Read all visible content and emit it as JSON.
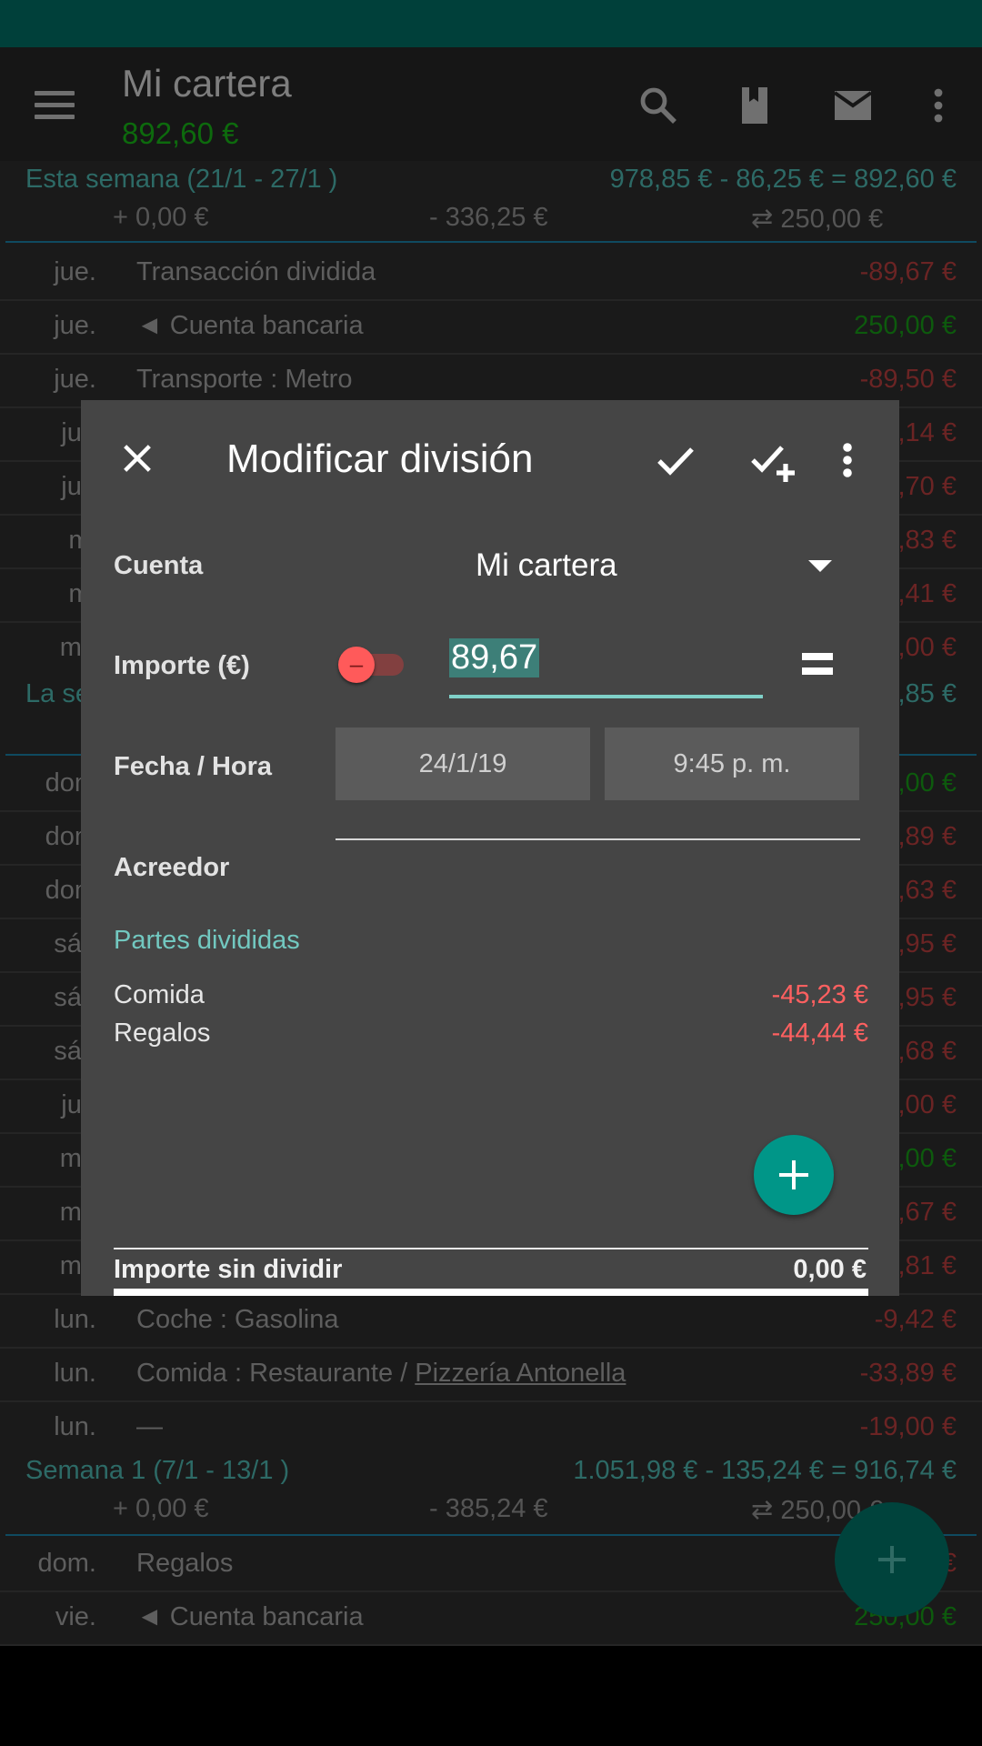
{
  "app": {
    "title": "Mi cartera",
    "balance": "892,60 €",
    "colors": {
      "accent": "#009688",
      "negative": "#ff6060",
      "positive": "#1a9a1a",
      "header_teal": "#72c8c0"
    }
  },
  "toolbar_icons": [
    "search-icon",
    "book-icon",
    "mail-icon",
    "more-vert-icon"
  ],
  "week1": {
    "title": "Esta semana (21/1 - 27/1 )",
    "total": "978,85 € - 86,25 € = 892,60 €",
    "income": "+ 0,00 €",
    "expense": "- 336,25 €",
    "transfer": "⇄ 250,00 €"
  },
  "rows_top": [
    {
      "day": "jue.",
      "desc": "Transacción dividida",
      "amount": "-89,67 €",
      "sign": "neg"
    },
    {
      "day": "jue.",
      "desc": "◄ Cuenta bancaria",
      "amount": "250,00 €",
      "sign": "pos"
    },
    {
      "day": "jue.",
      "desc": "Transporte : Metro",
      "amount": "-89,50 €",
      "sign": "neg"
    },
    {
      "day": "jue",
      "desc": "",
      "amount": ",14 €",
      "sign": "neg"
    },
    {
      "day": "jue",
      "desc": "",
      "amount": ",70 €",
      "sign": "neg"
    },
    {
      "day": "mi",
      "desc": "",
      "amount": ",83 €",
      "sign": "neg"
    },
    {
      "day": "mi",
      "desc": "",
      "amount": ",41 €",
      "sign": "neg"
    },
    {
      "day": "ma",
      "desc": "",
      "amount": ",00 €",
      "sign": "neg"
    }
  ],
  "week2": {
    "title": "La se",
    "total": ",85 €"
  },
  "rows_mid": [
    {
      "day": "dom",
      "amount": ",00 €",
      "sign": "pos"
    },
    {
      "day": "dom",
      "amount": ",89 €",
      "sign": "neg"
    },
    {
      "day": "dom",
      "amount": ",63 €",
      "sign": "neg"
    },
    {
      "day": "sáb",
      "amount": ",95 €",
      "sign": "neg"
    },
    {
      "day": "sáb",
      "amount": ",95 €",
      "sign": "neg"
    },
    {
      "day": "sáb",
      "amount": ",68 €",
      "sign": "neg"
    },
    {
      "day": "jue",
      "amount": ",00 €",
      "sign": "neg"
    },
    {
      "day": "ma",
      "amount": ",00 €",
      "sign": "pos"
    },
    {
      "day": "ma",
      "amount": ",67 €",
      "sign": "neg"
    },
    {
      "day": "ma",
      "amount": ",81 €",
      "sign": "neg"
    }
  ],
  "rows_bottom": [
    {
      "day": "lun.",
      "desc": "Coche : Gasolina",
      "amount": "-9,42 €",
      "sign": "neg"
    },
    {
      "day": "lun.",
      "desc": "Comida : Restaurante / ",
      "payee": "Pizzería Antonella",
      "amount": "-33,89 €",
      "sign": "neg"
    },
    {
      "day": "lun.",
      "desc": "—",
      "amount": "-19,00 €",
      "sign": "neg"
    }
  ],
  "week3": {
    "title": "Semana 1 (7/1 - 13/1 )",
    "total": "1.051,98 € - 135,24 € = 916,74 €",
    "income": "+ 0,00 €",
    "expense": "- 385,24 €",
    "transfer": "⇄ 250,00 €"
  },
  "rows_last": [
    {
      "day": "dom.",
      "desc": "Regalos",
      "amount": "€",
      "sign": "neg"
    },
    {
      "day": "vie.",
      "desc": "◄ Cuenta bancaria",
      "amount": "250,00 €",
      "sign": "pos"
    }
  ],
  "dialog": {
    "title": "Modificar división",
    "account_label": "Cuenta",
    "account_value": "Mi cartera",
    "amount_label": "Importe (€)",
    "amount_value": "89,67",
    "toggle_symbol": "–",
    "datetime_label": "Fecha / Hora",
    "date": "24/1/19",
    "time": "9:45 p. m.",
    "payee_label": "Acreedor",
    "payee_value": "",
    "splits_header": "Partes divididas",
    "splits": [
      {
        "category": "Comida",
        "amount": "-45,23 €"
      },
      {
        "category": "Regalos",
        "amount": "-44,44 €"
      }
    ],
    "unsplit_label": "Importe sin dividir",
    "unsplit_value": "0,00 €"
  }
}
